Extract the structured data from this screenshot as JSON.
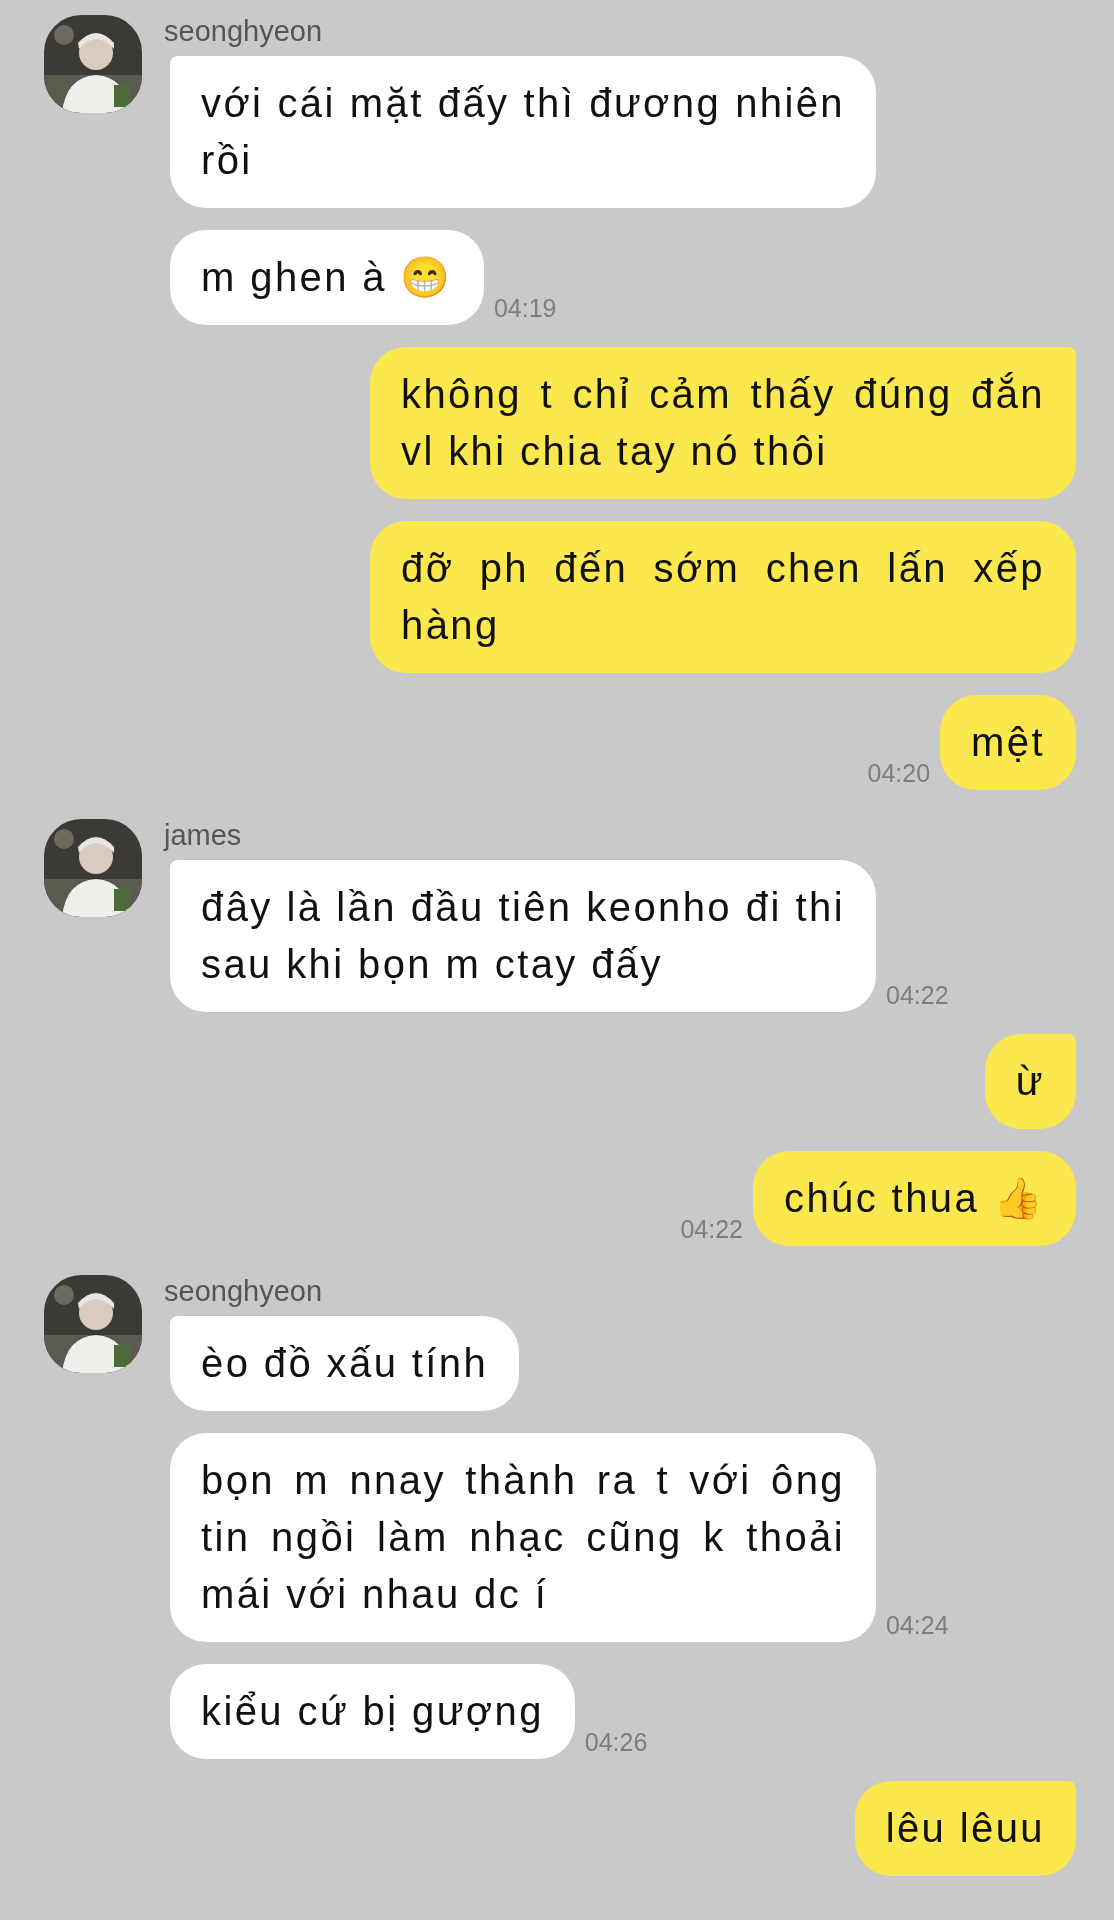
{
  "conversation": [
    {
      "kind": "incoming",
      "sender": "seonghyeon",
      "messages": [
        {
          "text": "với cái mặt đấy thì đương nhiên rồi"
        },
        {
          "text": "m ghen à 😁",
          "time": "04:19"
        }
      ]
    },
    {
      "kind": "outgoing",
      "messages": [
        {
          "text": "không t chỉ cảm thấy đúng đắn vl khi chia tay nó thôi"
        },
        {
          "text": "đỡ ph đến sớm chen lấn xếp hàng"
        },
        {
          "text": "mệt",
          "time": "04:20"
        }
      ]
    },
    {
      "kind": "incoming",
      "sender": "james",
      "messages": [
        {
          "text": "đây là lần đầu tiên keonho đi thi sau khi bọn m ctay đấy",
          "time": "04:22"
        }
      ]
    },
    {
      "kind": "outgoing",
      "messages": [
        {
          "text": "ừ"
        },
        {
          "text": "chúc thua 👍",
          "time": "04:22"
        }
      ]
    },
    {
      "kind": "incoming",
      "sender": "seonghyeon",
      "messages": [
        {
          "text": "èo đồ xấu tính"
        },
        {
          "text": "bọn m nnay thành ra t với ông tin ngồi làm nhạc cũng k thoải mái với nhau dc í",
          "time": "04:24"
        },
        {
          "text": "kiểu cứ bị gượng",
          "time": "04:26"
        }
      ]
    },
    {
      "kind": "outgoing",
      "messages": [
        {
          "text": "lêu lêuu"
        }
      ]
    }
  ]
}
